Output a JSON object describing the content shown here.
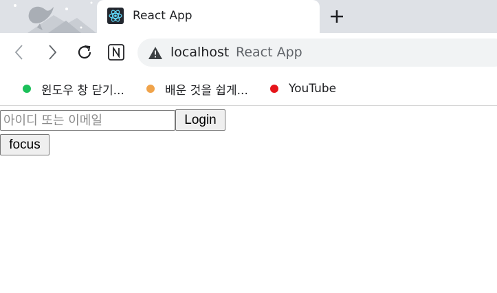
{
  "browser": {
    "tab": {
      "title": "React App",
      "favicon_icon": "react-logo-icon"
    },
    "new_tab_icon": "plus-icon",
    "nav": {
      "back_icon": "chevron-left-icon",
      "forward_icon": "chevron-right-icon",
      "reload_icon": "reload-icon",
      "extension_icon": "notion-icon"
    },
    "omnibox": {
      "security_icon": "warning-triangle-icon",
      "host": "localhost",
      "page_title": "React App"
    },
    "bookmarks": [
      {
        "label": "윈도우 창 닫기...",
        "color": "#1cc05a"
      },
      {
        "label": "배운 것을 쉽게...",
        "color": "#f0a34a"
      },
      {
        "label": "YouTube",
        "color": "#e5151a"
      }
    ]
  },
  "page": {
    "id_input": {
      "placeholder": "아이디 또는 이메일",
      "value": ""
    },
    "login_label": "Login",
    "focus_label": "focus"
  },
  "colors": {
    "tab_strip": "#dee1e6",
    "omnibox_bg": "#f1f3f4",
    "button_bg": "#efefef"
  }
}
